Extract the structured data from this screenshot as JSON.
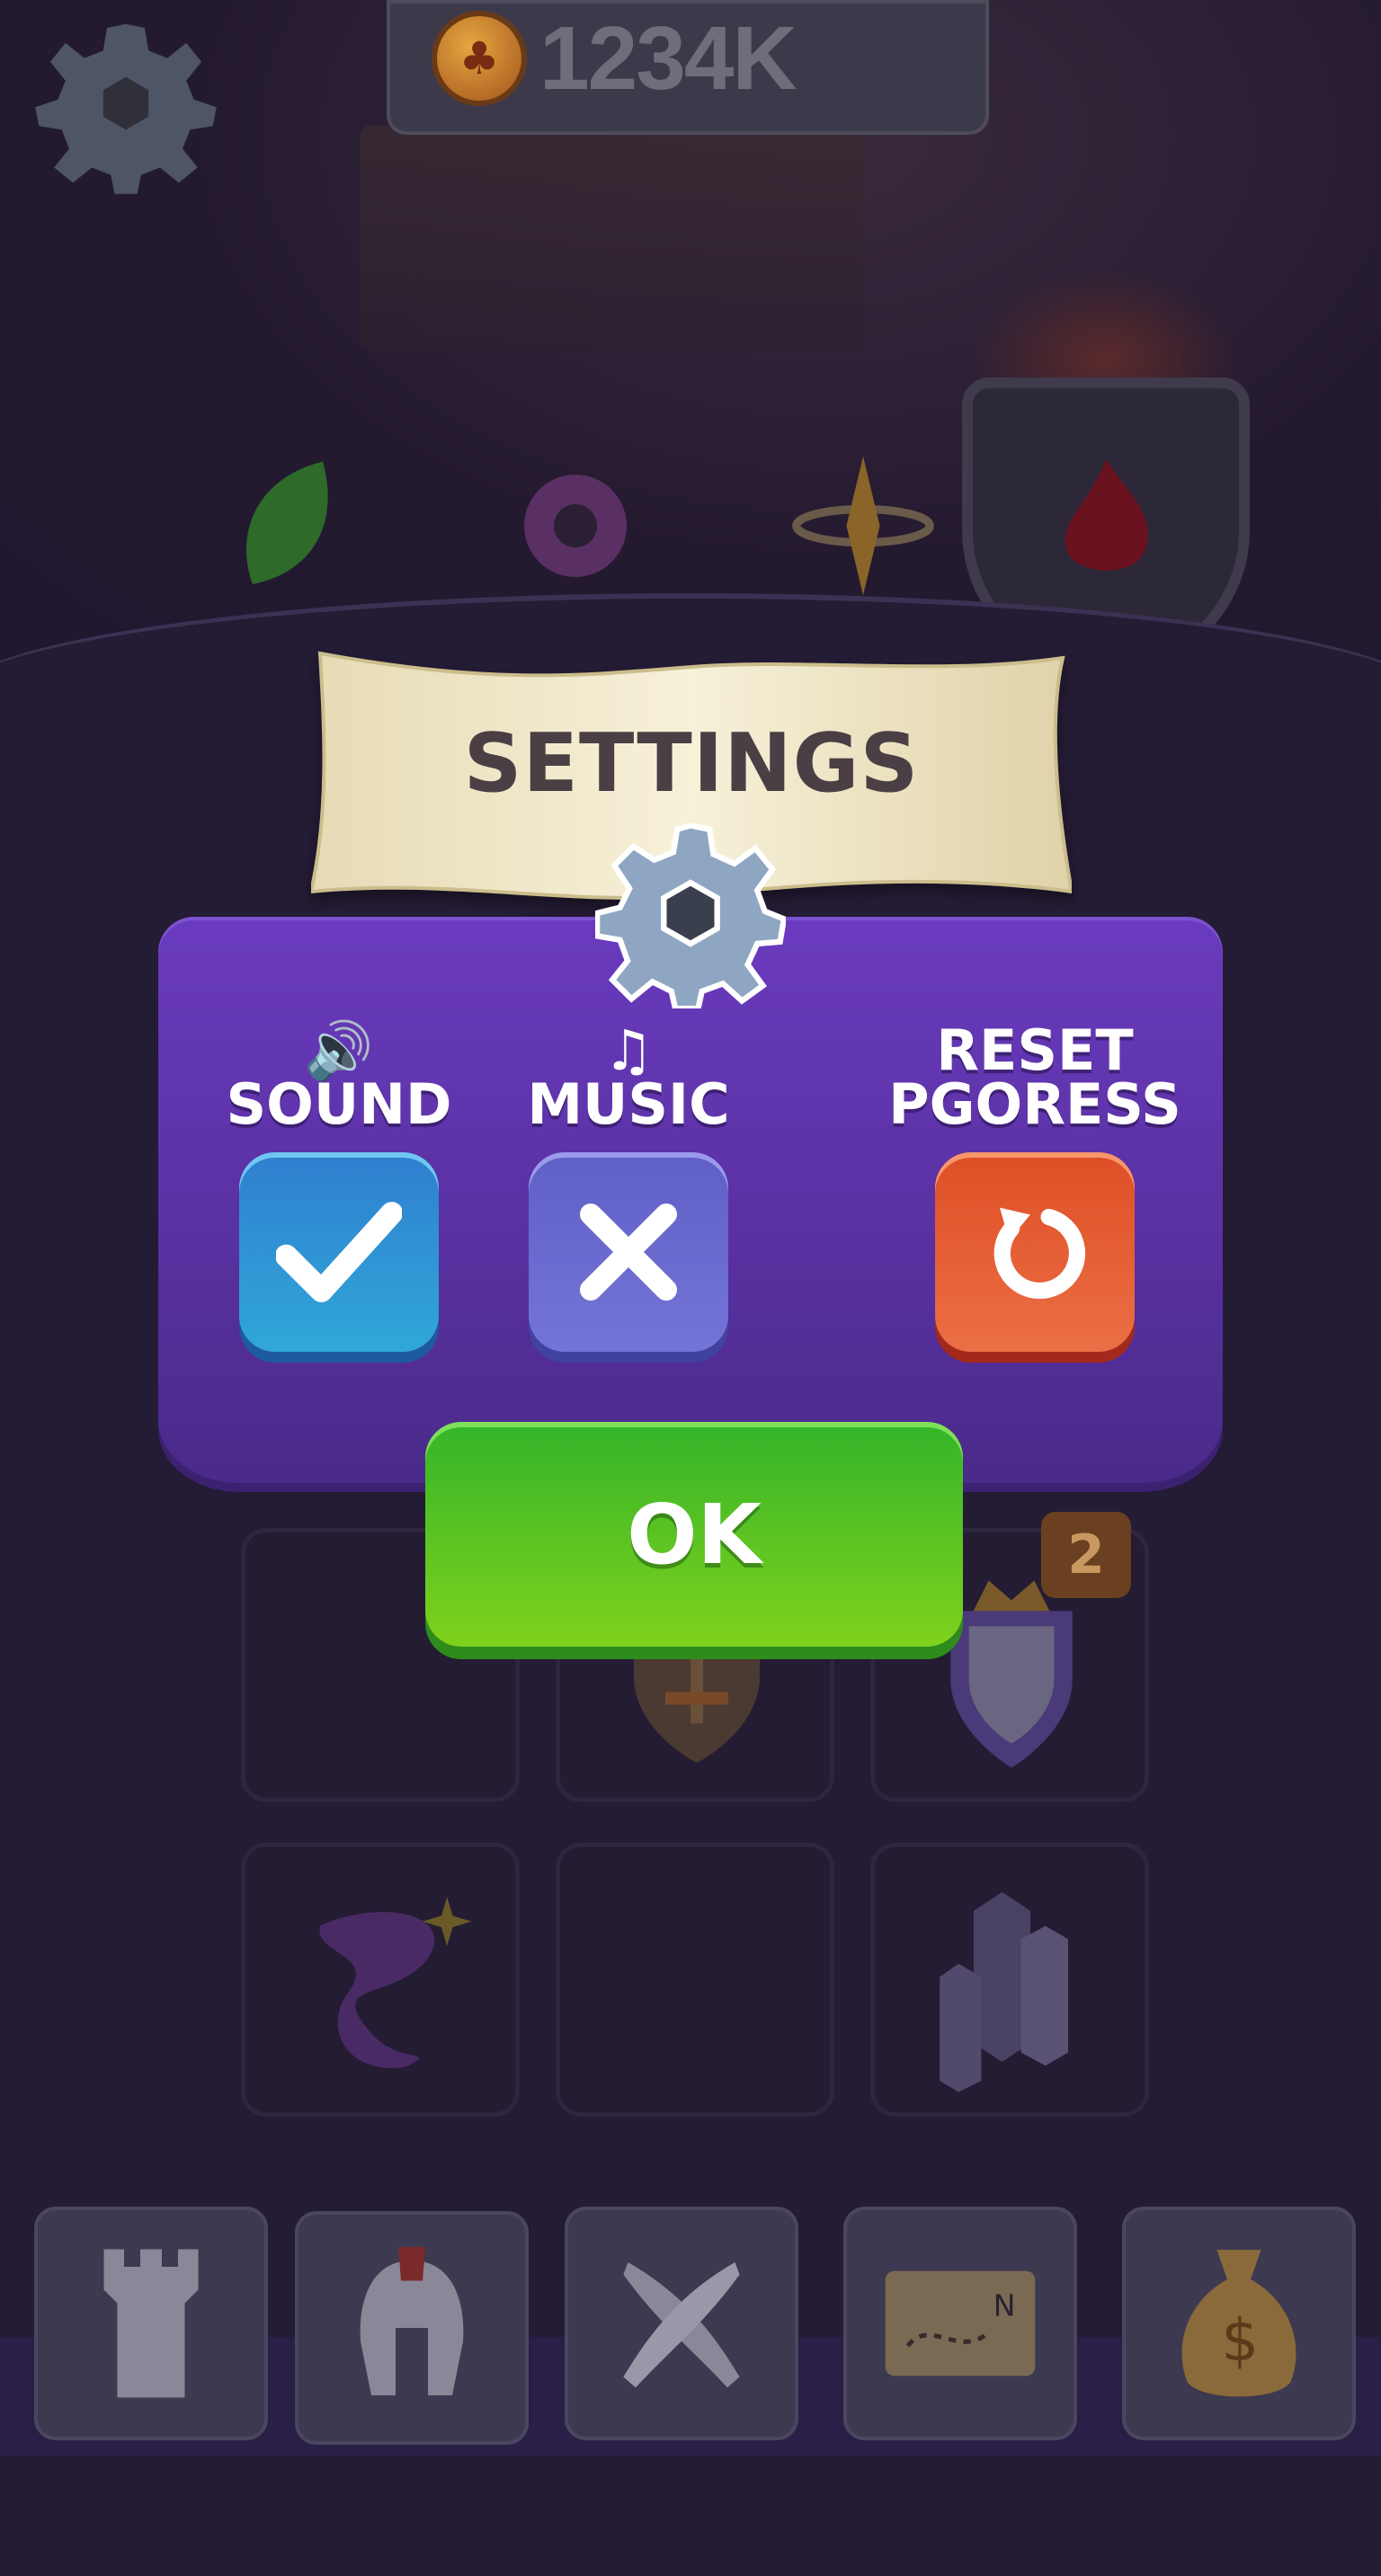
{
  "hud": {
    "coins": "1234K",
    "coin_icon": "coin-clover-icon",
    "settings_icon": "gear-icon"
  },
  "dialog": {
    "title": "SETTINGS",
    "header_icon": "gear-icon",
    "sound": {
      "label": "SOUND",
      "icon": "speaker-icon",
      "state": "on"
    },
    "music": {
      "label": "MUSIC",
      "icon": "music-note-icon",
      "state": "off"
    },
    "reset": {
      "label_line1": "RESET",
      "label_line2": "PGORESS",
      "icon": "reset-arrow-icon"
    },
    "ok_label": "OK"
  },
  "background": {
    "card_badge": "2",
    "tabs": [
      "tower-icon",
      "helmet-icon",
      "crossed-swords-icon",
      "treasure-map-icon",
      "money-bag-icon"
    ]
  },
  "colors": {
    "panel": "#5e34ad",
    "sound_button": "#30a7d9",
    "music_button": "#6a6ad2",
    "reset_button": "#e65b32",
    "ok_button": "#5cc322"
  }
}
